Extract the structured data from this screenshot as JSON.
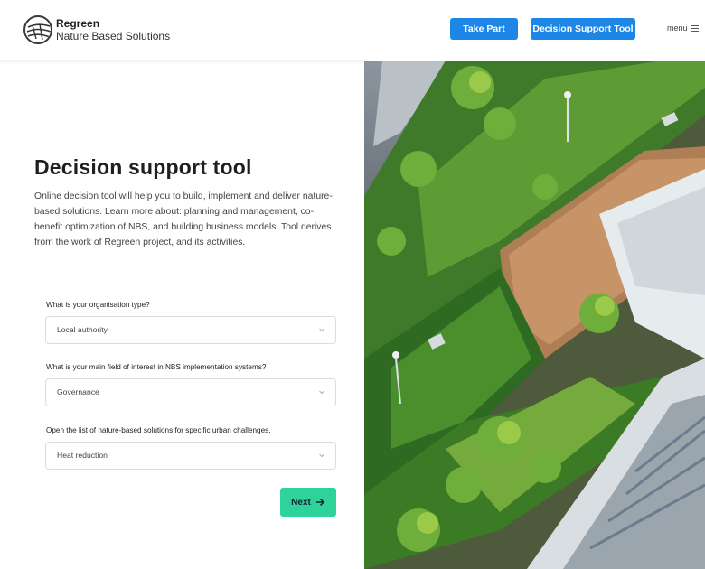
{
  "brand": {
    "name": "Regreen",
    "subtitle": "Nature Based Solutions"
  },
  "nav": {
    "take_part": "Take Part",
    "decision_support_tool": "Decision Support Tool",
    "menu": "menu"
  },
  "main": {
    "title": "Decision support tool",
    "description": "Online decision tool will help you to build, implement and deliver nature-based solutions. Learn more about: planning and management, co-benefit optimization of NBS, and building business models. Tool derives from the work of Regreen project, and its activities.",
    "questions": [
      {
        "label": "What is your organisation type?",
        "value": "Local authority"
      },
      {
        "label": "What is your main field of interest in NBS implementation systems?",
        "value": "Governance"
      },
      {
        "label": "Open the list of nature-based solutions for specific urban challenges.",
        "value": "Heat reduction"
      }
    ],
    "next_label": "Next"
  },
  "colors": {
    "primary_blue": "#1e86e6",
    "next_green": "#2ed39a"
  },
  "icons": {
    "logo": "regreen-logo-icon",
    "menu": "menu-icon",
    "chevron": "chevron-down-icon",
    "arrow": "arrow-right-icon"
  }
}
